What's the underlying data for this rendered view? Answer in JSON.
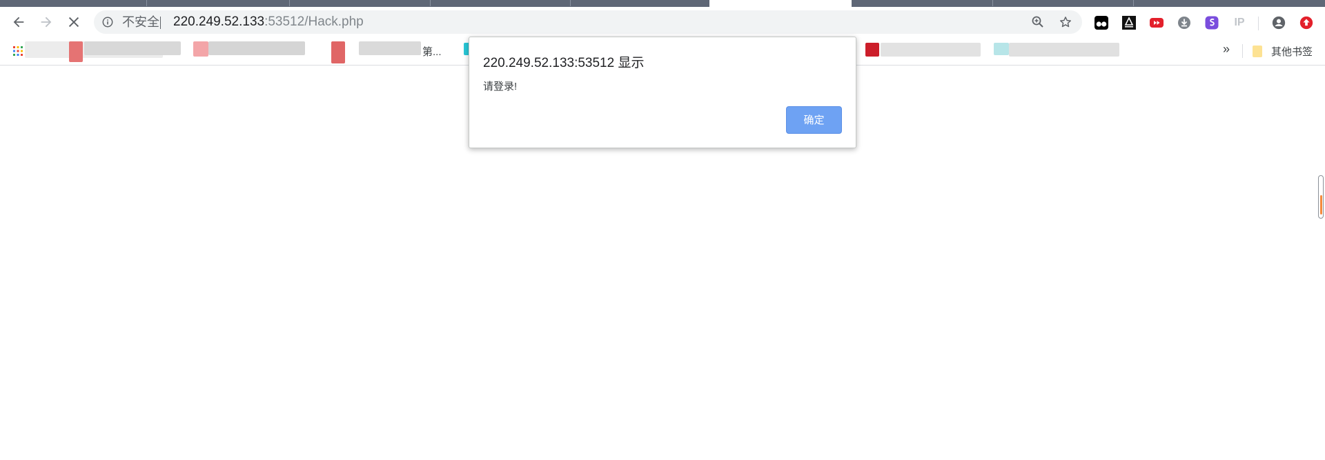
{
  "browser": {
    "security_label": "不安全",
    "url_host": "220.249.52.133",
    "url_rest": ":53512/Hack.php",
    "bookmark_truncated_text": "第...",
    "bookmarks_overflow": "»",
    "other_bookmarks_label": "其他书签",
    "ip_extension_label": "IP"
  },
  "dialog": {
    "title": "220.249.52.133:53512 显示",
    "message": "请登录!",
    "ok_label": "确定"
  },
  "colors": {
    "accent_button": "#6ea2f3",
    "tab_strip_inactive": "#5f6776",
    "omnibox_bg": "#f1f3f4",
    "scroll_indicator": "#f58a3c"
  }
}
